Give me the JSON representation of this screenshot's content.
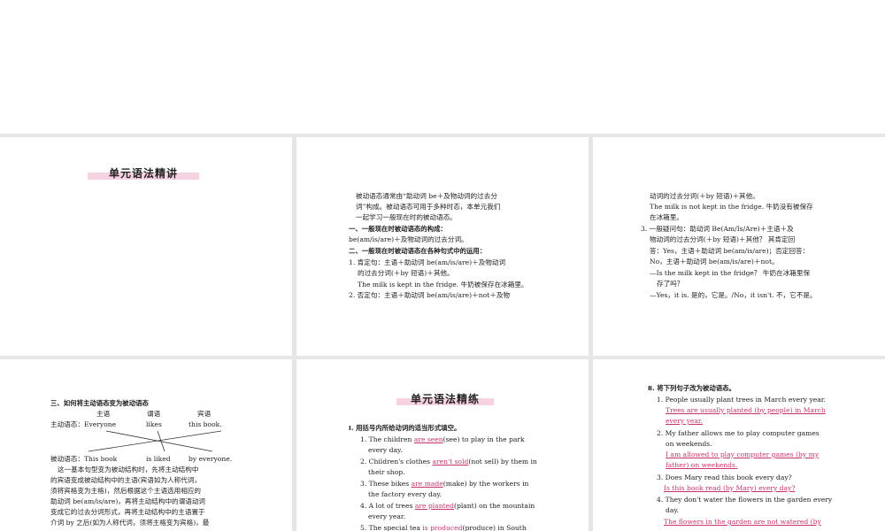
{
  "slide1": {
    "title": "单元语法精讲"
  },
  "slide2": {
    "lines": [
      "被动语态通常由“助动词 be＋及物动词的过去分",
      "词”构成。被动语态可用于多种时态，本单元我们",
      "一起学习一般现在时的被动语态。",
      "一、一般现在时被动语态的构成：",
      "be(am/is/are)＋及物动词的过去分词。",
      "二、一般现在时被动语态在各种句式中的运用：",
      "1. 肯定句：主语＋助动词 be(am/is/are)＋及物动词",
      "的过去分词(＋by 短语)＋其他。",
      "The milk is kept in the fridge. 牛奶被保存在冰箱里。",
      "2. 否定句：主语＋助动词 be(am/is/are)＋not＋及物"
    ]
  },
  "slide3": {
    "lines": [
      "动词的过去分词(＋by 短语)＋其他。",
      "The milk is not kept in the fridge. 牛奶没有被保存",
      "在冰箱里。",
      "3. 一般疑问句：助动词 Be(Am/Is/Are)＋主语＋及",
      "物动词的过去分词(＋by 短语)＋其他？ 其肯定回",
      "答：Yes，主语＋助动词 be(am/is/are)；否定回答：",
      "No，主语＋助动词 be(am/is/are)＋not。",
      "—Is the milk kept in the fridge？ 牛奶在冰箱里保",
      "存了吗？",
      "—Yes，it is. 是的，它是。/No，it isn't. 不，它不是。"
    ]
  },
  "slide4": {
    "heading": "三、如何将主动语态变为被动语态",
    "col_subject": "主语",
    "col_predicate": "谓语",
    "col_object": "宾语",
    "active_label": "主动语态：Everyone",
    "active_verb": "likes",
    "active_object": "this book.",
    "passive_label": "被动语态：This book",
    "passive_verb": "is liked",
    "passive_by": "by everyone.",
    "lines": [
      "这一基本句型变为被动结构时，先将主动结构中",
      "的宾语变成被动结构中的主语(宾语如为人称代词，",
      "须将宾格变为主格)，然后根据这个主语选用相应的",
      "助动词 be(am/is/are)，再将主动结构中的谓语动词",
      "变成它的过去分词形式，再将主动结构中的主语置于",
      "介词 by 之后(如为人称代词，须将主格变为宾格)，最"
    ]
  },
  "slide5": {
    "title": "单元语法精练",
    "section": "Ⅰ. 用括号内所给动词的适当形式填空。",
    "items": [
      {
        "pre": "1. The children ",
        "ans": "are seen",
        "post": "(see) to play in the park"
      },
      {
        "pre": "every day.",
        "ans": "",
        "post": ""
      },
      {
        "pre": "2. Children's clothes ",
        "ans": "aren't sold",
        "post": "(not sell) by them in"
      },
      {
        "pre": "their shop.",
        "ans": "",
        "post": ""
      },
      {
        "pre": "3. These bikes ",
        "ans": "are made",
        "post": "(make) by the workers in"
      },
      {
        "pre": "the factory every day.",
        "ans": "",
        "post": ""
      },
      {
        "pre": "4. A lot of trees ",
        "ans": "are planted",
        "post": "(plant) on the mountain"
      },
      {
        "pre": "every year.",
        "ans": "",
        "post": ""
      },
      {
        "pre": "5. The special tea ",
        "ans": "is produced",
        "post": "(produce) in South"
      }
    ]
  },
  "slide6": {
    "section": "Ⅱ. 将下列句子改为被动语态。",
    "lines": [
      {
        "text": "1. People usually plant trees in March every year.",
        "ans": false
      },
      {
        "text": "Trees are usually planted (by people) in March",
        "ans": true
      },
      {
        "text": "every year.",
        "ans": true
      },
      {
        "text": "2. My father allows me to play computer games",
        "ans": false
      },
      {
        "text": "on weekends.",
        "ans": false
      },
      {
        "text": "I am allowed to play computer games (by my",
        "ans": true
      },
      {
        "text": "father) on weekends.",
        "ans": true
      },
      {
        "text": "3. Does Mary read this book every day?",
        "ans": false
      },
      {
        "text": "Is this book read (by Mary) every day?",
        "ans": true
      },
      {
        "text": "4. They don't water the flowers in the garden every",
        "ans": false
      },
      {
        "text": "day.",
        "ans": false
      },
      {
        "text": "The flowers in the garden are not watered (by",
        "ans": true
      }
    ]
  },
  "colors": {
    "highlight": "#f7d2e2",
    "answer": "#c8336f",
    "gutter": "#e6e6e6"
  }
}
